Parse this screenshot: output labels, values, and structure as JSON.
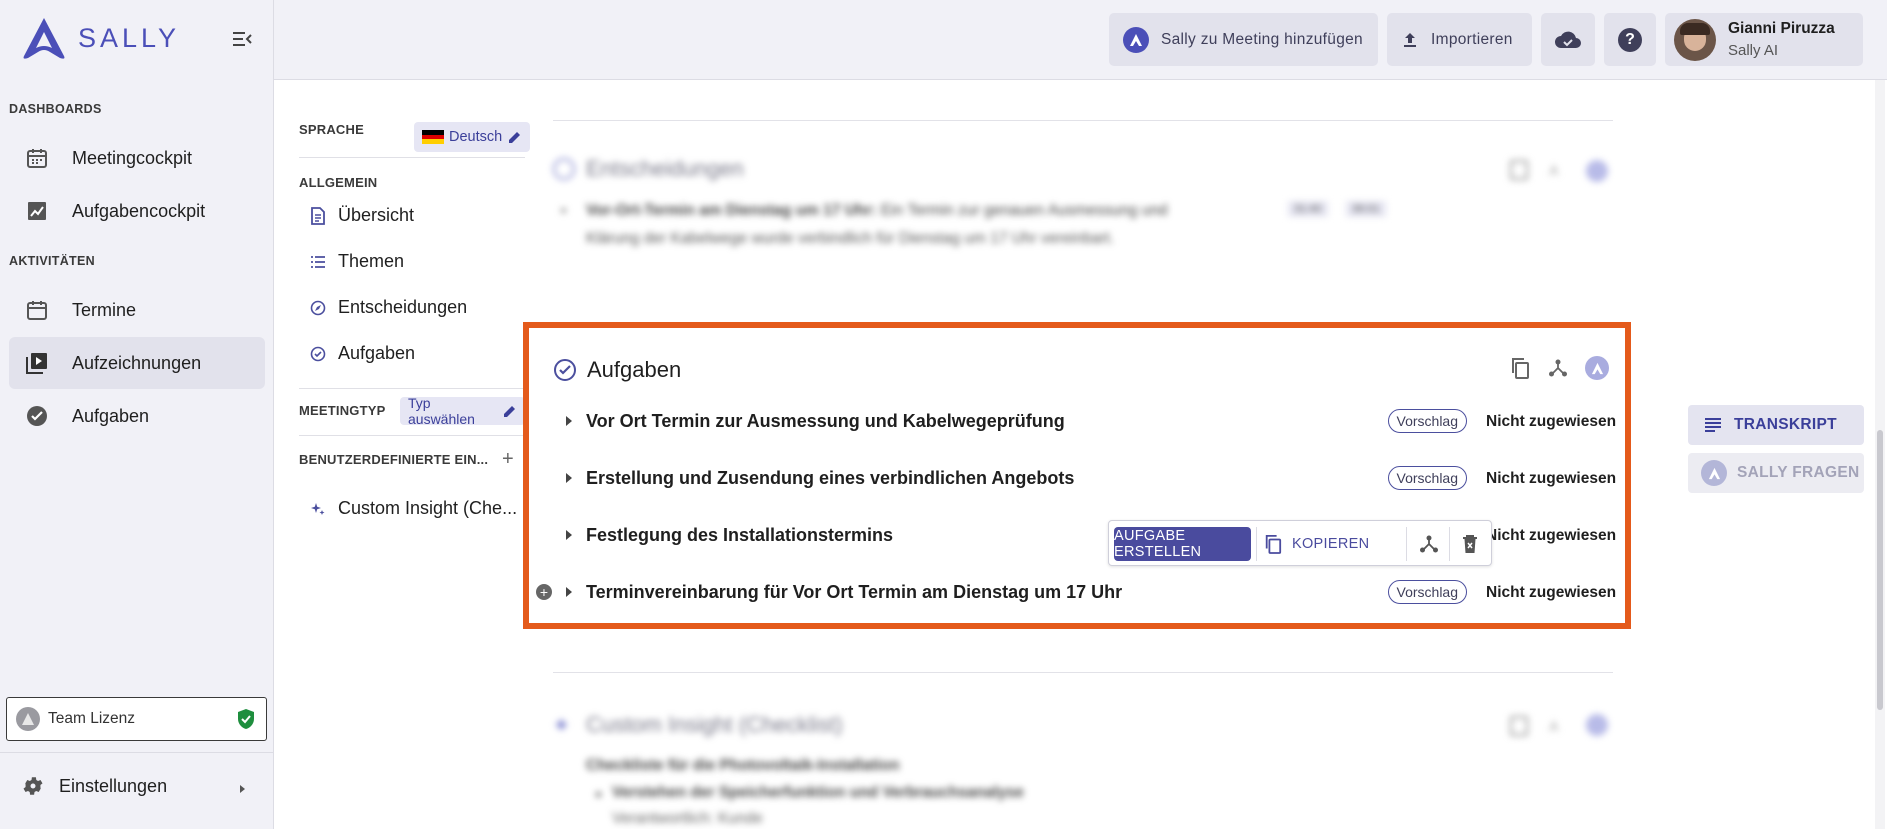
{
  "app": {
    "logo_text": "SALLY",
    "brand_color": "#4b4fb8",
    "accent_color": "#4a4b9e",
    "highlight_color": "#e45a1b"
  },
  "sidebar": {
    "dashboards_label": "DASHBOARDS",
    "activities_label": "AKTIVITÄTEN",
    "items": [
      {
        "label": "Meetingcockpit",
        "icon": "calendar-dashboard-icon"
      },
      {
        "label": "Aufgabencockpit",
        "icon": "chart-icon"
      },
      {
        "label": "Termine",
        "icon": "calendar-icon"
      },
      {
        "label": "Aufzeichnungen",
        "icon": "video-library-icon",
        "active": true
      },
      {
        "label": "Aufgaben",
        "icon": "check-circle-icon"
      }
    ],
    "license_label": "Team Lizenz",
    "settings_label": "Einstellungen"
  },
  "header": {
    "add_meeting_label": "Sally zu Meeting hinzufügen",
    "import_label": "Importieren",
    "user_name": "Gianni Piruzza",
    "user_company": "Sally AI"
  },
  "nav": {
    "language_label": "SPRACHE",
    "language_value": "Deutsch",
    "general_label": "ALLGEMEIN",
    "links": [
      "Übersicht",
      "Themen",
      "Entscheidungen",
      "Aufgaben"
    ],
    "meeting_type_label": "MEETINGTYP",
    "meeting_type_value": "Typ auswählen",
    "custom_label": "BENUTZERDEFINIERTE EIN...",
    "custom_link": "Custom Insight (Che..."
  },
  "main": {
    "decisions": {
      "title": "Entscheidungen",
      "item_title": "Vor-Ort-Termin am Dienstag um 17 Uhr:",
      "item_text_1": "Ein Termin zur genauen Ausmessung und",
      "item_text_2": "Klärung der Kabelwege wurde verbindlich für Dienstag um 17 Uhr vereinbart.",
      "time_start": "31:40",
      "time_end": "36:01"
    },
    "tasks": {
      "title": "Aufgaben",
      "items": [
        {
          "title": "Vor Ort Termin zur Ausmessung und Kabelwegeprüfung",
          "badge": "Vorschlag",
          "assignee": "Nicht zugewiesen"
        },
        {
          "title": "Erstellung und Zusendung eines verbindlichen Angebots",
          "badge": "Vorschlag",
          "assignee": "Nicht zugewiesen"
        },
        {
          "title": "Festlegung des Installationstermins",
          "badge": "",
          "assignee": "Nicht zugewiesen"
        },
        {
          "title": "Terminvereinbarung für Vor Ort Termin am Dienstag um 17 Uhr",
          "badge": "Vorschlag",
          "assignee": "Nicht zugewiesen"
        }
      ],
      "toolbar": {
        "create_label": "AUFGABE ERSTELLEN",
        "copy_label": "KOPIEREN"
      }
    },
    "custom_insight": {
      "title": "Custom Insight (Checklist)",
      "subtitle": "Checkliste für die Photovoltaik-Installation",
      "bullet": "Verstehen der Speicherfunktion und Verbrauchsanalyse",
      "responsible": "Verantwortlich: Kunde"
    }
  },
  "right_panel": {
    "transcript_label": "TRANSKRIPT",
    "ask_label": "SALLY FRAGEN"
  }
}
